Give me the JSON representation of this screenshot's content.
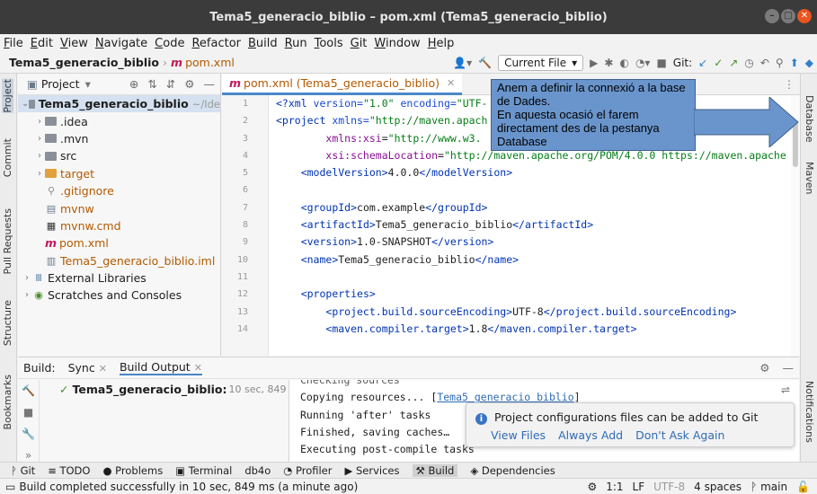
{
  "window": {
    "title": "Tema5_generacio_biblio – pom.xml (Tema5_generacio_biblio)"
  },
  "menu": [
    "File",
    "Edit",
    "View",
    "Navigate",
    "Code",
    "Refactor",
    "Build",
    "Run",
    "Tools",
    "Git",
    "Window",
    "Help"
  ],
  "navbar": {
    "project": "Tema5_generacio_biblio",
    "file": "pom.xml",
    "run_config": "Current File",
    "git_label": "Git:"
  },
  "left_tabs": [
    "Project",
    "Commit",
    "Pull Requests",
    "Structure",
    "Bookmarks"
  ],
  "right_tabs": [
    "Database",
    "Maven",
    "Notifications"
  ],
  "project_panel": {
    "title": "Project",
    "items": [
      {
        "label": "Tema5_generacio_biblio",
        "suffix": "~/Ide"
      },
      {
        "label": ".idea"
      },
      {
        "label": ".mvn"
      },
      {
        "label": "src"
      },
      {
        "label": "target"
      },
      {
        "label": ".gitignore"
      },
      {
        "label": "mvnw"
      },
      {
        "label": "mvnw.cmd"
      },
      {
        "label": "pom.xml"
      },
      {
        "label": "Tema5_generacio_biblio.iml"
      },
      {
        "label": "External Libraries"
      },
      {
        "label": "Scratches and Consoles"
      }
    ]
  },
  "editor": {
    "tab": "pom.xml (Tema5_generacio_biblio)",
    "line_numbers": [
      "1",
      "2",
      "3",
      "4",
      "5",
      "6",
      "7",
      "8",
      "9",
      "10",
      "11",
      "12",
      "13",
      "14"
    ]
  },
  "callout": {
    "text": "Anem a definir la connexió a la base de Dades.\nEn aquesta ocasió el farem directament des de la pestanya Database",
    "color": "#6a95cc"
  },
  "build": {
    "label": "Build:",
    "tabs": [
      "Sync",
      "Build Output"
    ],
    "tree_item": "Tema5_generacio_biblio:",
    "tree_time": "10 sec, 849 ms",
    "output": {
      "line0": "Checking sources",
      "line1_prefix": "Copying resources... [",
      "line1_link": "Tema5_generacio_biblio",
      "line1_suffix": "]",
      "line2": "Running 'after' tasks",
      "line3": "Finished, saving caches…",
      "line4": "Executing post-compile tasks"
    }
  },
  "notification": {
    "message": "Project configurations files can be added to Git",
    "actions": [
      "View Files",
      "Always Add",
      "Don't Ask Again"
    ]
  },
  "bottom_tabs": [
    "Git",
    "TODO",
    "Problems",
    "Terminal",
    "db4o",
    "Profiler",
    "Services",
    "Build",
    "Dependencies"
  ],
  "status": {
    "message": "Build completed successfully in 10 sec, 849 ms (a minute ago)",
    "position": "1:1",
    "line_sep": "LF",
    "encoding": "UTF-8",
    "indent": "4 spaces",
    "branch": "main"
  }
}
